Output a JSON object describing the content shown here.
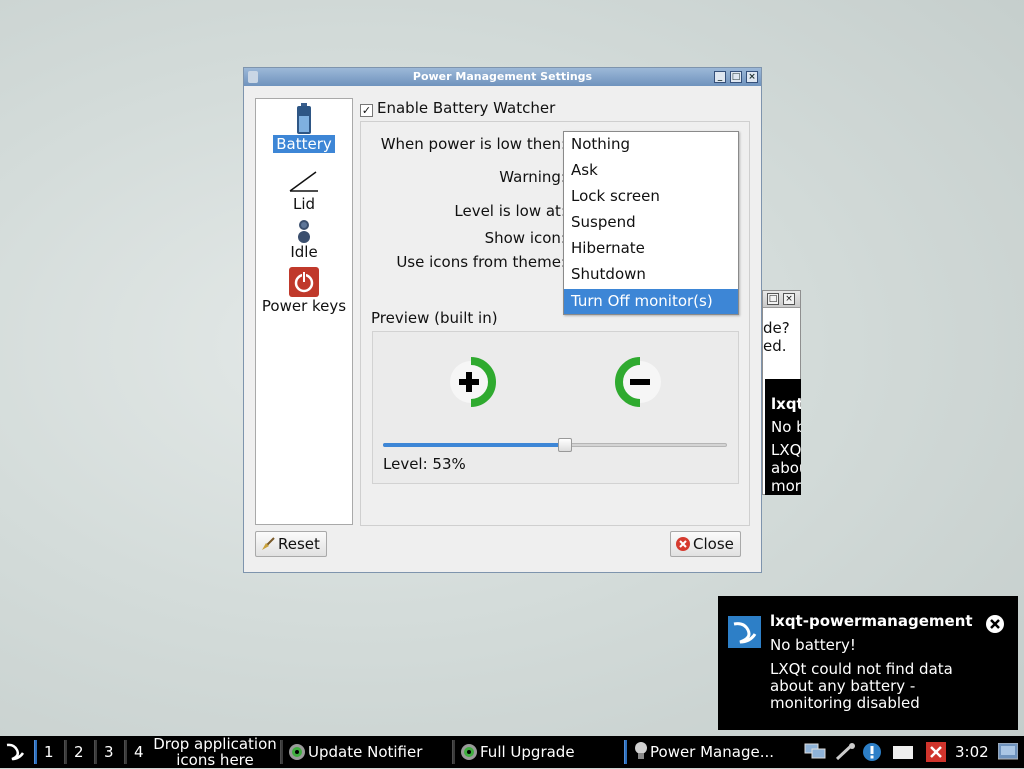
{
  "dialog": {
    "title": "Power Management Settings",
    "sidebar": [
      {
        "label": "Battery",
        "icon": "battery-icon",
        "selected": true
      },
      {
        "label": "Lid",
        "icon": "lid-icon",
        "selected": false
      },
      {
        "label": "Idle",
        "icon": "idle-user-icon",
        "selected": false
      },
      {
        "label": "Power keys",
        "icon": "power-button-icon",
        "selected": false
      }
    ],
    "enable_battery_watcher": {
      "label": "Enable Battery Watcher",
      "checked": true
    },
    "fields": {
      "when_low": "When power is low then:",
      "warning": "Warning:",
      "level_low": "Level is low at:",
      "show_icon": "Show icon:",
      "icons_theme": "Use icons from theme:"
    },
    "dropdown_options": [
      "Nothing",
      "Ask",
      "Lock screen",
      "Suspend",
      "Hibernate",
      "Shutdown",
      "Turn Off monitor(s)"
    ],
    "dropdown_selected_index": 6,
    "preview": {
      "label": "Preview (built in)",
      "level_text": "Level: 53%",
      "level": 53
    },
    "buttons": {
      "reset": "Reset",
      "close": "Close"
    }
  },
  "background_window": {
    "lines": [
      "de?",
      "ed."
    ],
    "notif_lines": [
      "lxqt",
      "No b",
      "LXQ",
      "abou",
      "mor"
    ]
  },
  "notification": {
    "title": "lxqt-powermanagement",
    "line1": "No battery!",
    "line2": "LXQt could not find data",
    "line3": "about any battery -",
    "line4": "monitoring disabled"
  },
  "taskbar": {
    "desktops": [
      "1",
      "2",
      "3",
      "4"
    ],
    "quicklaunch": [
      "Drop application",
      "icons here"
    ],
    "tasks": [
      "Update Notifier",
      "Full Upgrade",
      "Power Manage..."
    ],
    "clock": "3:02"
  },
  "colors": {
    "accent": "#3d86d6",
    "title_bar": "#6f93bd",
    "green": "#2faa2f",
    "power_red": "#c0392b"
  }
}
